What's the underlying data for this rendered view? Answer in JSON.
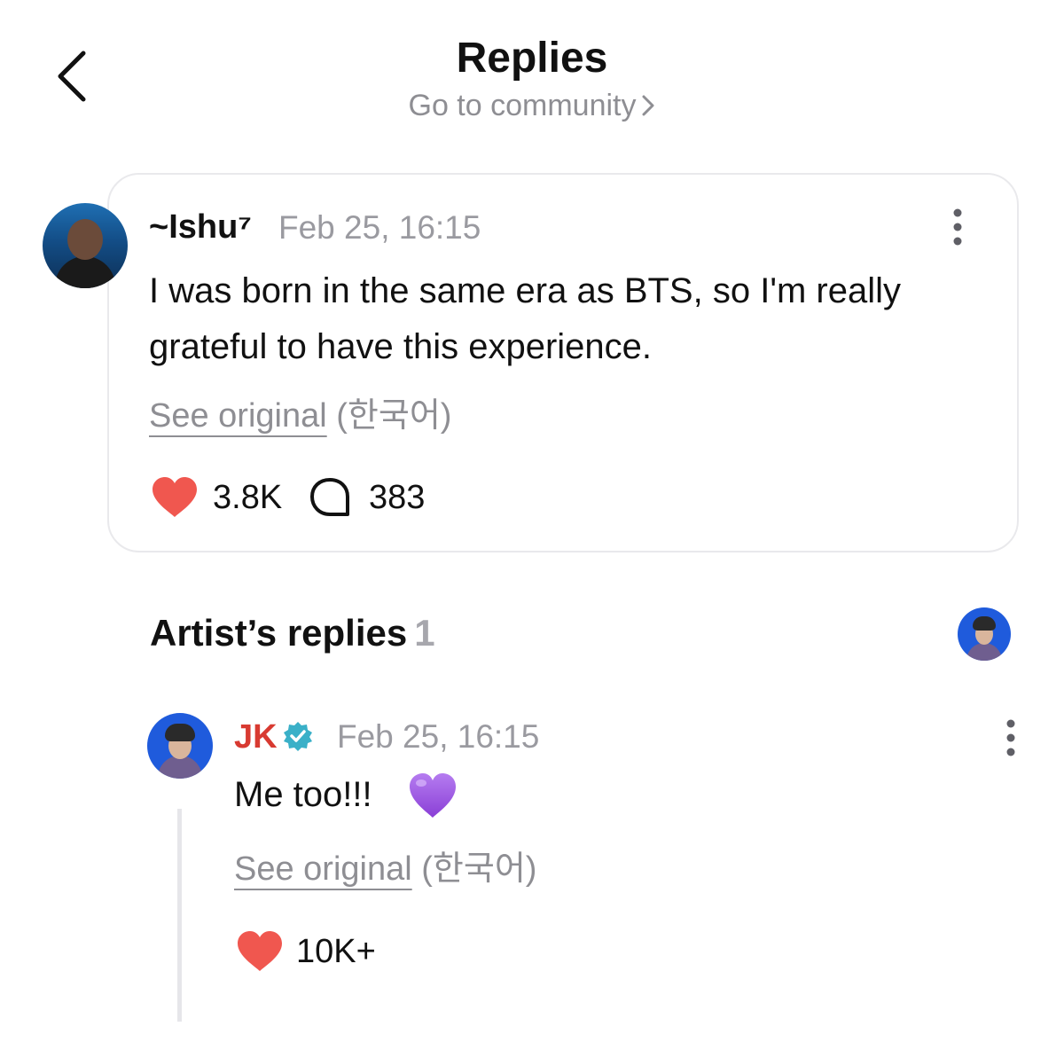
{
  "header": {
    "title": "Replies",
    "subtitle": "Go to community"
  },
  "post": {
    "author": "~Ishu⁷",
    "time": "Feb 25, 16:15",
    "body": "I was born in the same era as BTS, so I'm really grateful to have this experience.",
    "see_original": "See original",
    "language": "(한국어)",
    "likes": "3.8K",
    "comments": "383"
  },
  "artist_replies": {
    "title": "Artist’s replies",
    "count": "1",
    "reply": {
      "author": "JK",
      "time": "Feb 25, 16:15",
      "body": "Me too!!!",
      "see_original": "See original",
      "language": "(한국어)",
      "likes": "10K+"
    }
  },
  "colors": {
    "heart": "#f0574f",
    "artist_name": "#d83a31",
    "verified": "#3ab0c8",
    "muted_text": "#8e8e93"
  },
  "icons": [
    "back-arrow-icon",
    "chevron-right-icon",
    "more-vertical-icon",
    "heart-icon",
    "comment-bubble-icon",
    "verified-badge-icon",
    "purple-heart-emoji"
  ]
}
